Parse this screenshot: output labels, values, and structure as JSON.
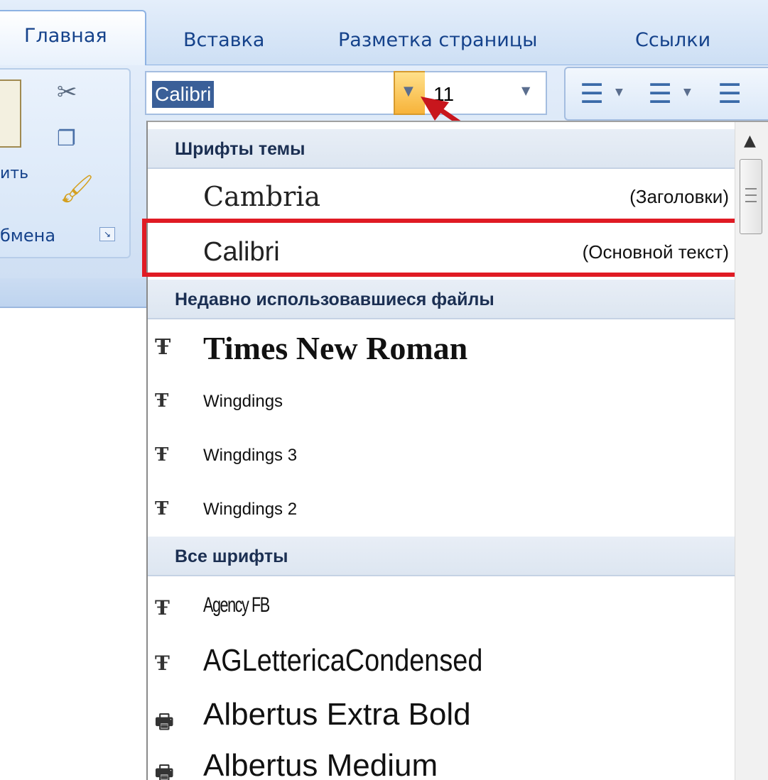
{
  "tabs": [
    {
      "label": "Главная",
      "active": true
    },
    {
      "label": "Вставка",
      "active": false
    },
    {
      "label": "Разметка страницы",
      "active": false
    },
    {
      "label": "Ссылки",
      "active": false
    }
  ],
  "clipboard": {
    "paste_label_fragment": "ить",
    "group_label_fragment": "бмена",
    "icons": [
      "paste-icon",
      "scissors-icon",
      "copy-icon",
      "format-painter-icon",
      "dialog-launcher-icon"
    ]
  },
  "font": {
    "current_value": "Calibri",
    "size_value": "11"
  },
  "menu": {
    "sections": {
      "theme_fonts": "Шрифты темы",
      "recent": "Недавно использовавшиеся файлы",
      "all": "Все шрифты"
    },
    "theme_fonts": [
      {
        "name": "Cambria",
        "role": "(Заголовки)"
      },
      {
        "name": "Calibri",
        "role": "(Основной текст)"
      }
    ],
    "recent_fonts": [
      {
        "name": "Times New Roman",
        "icon": "truetype-icon"
      },
      {
        "name": "Wingdings",
        "icon": "truetype-icon"
      },
      {
        "name": "Wingdings 3",
        "icon": "truetype-icon"
      },
      {
        "name": "Wingdings 2",
        "icon": "truetype-icon"
      }
    ],
    "all_fonts": [
      {
        "name": "Agency FB",
        "icon": "truetype-icon"
      },
      {
        "name": "AGLettericaCondensed",
        "icon": "truetype-icon"
      },
      {
        "name": "Albertus Extra Bold",
        "icon": "printer-font-icon"
      },
      {
        "name": "Albertus Medium",
        "icon": "printer-font-icon"
      }
    ]
  },
  "colors": {
    "accent": "#15428b",
    "highlight_border": "#e01b24",
    "pointer_arrow": "#c8161d",
    "dropdown_button": "#f7b33a"
  }
}
